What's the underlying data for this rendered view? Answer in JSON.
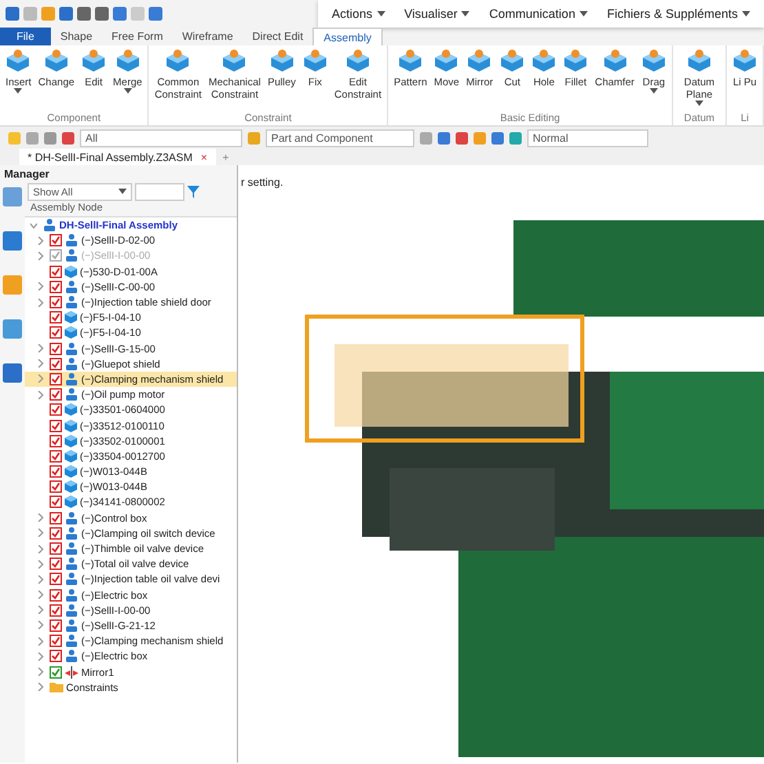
{
  "menu_bar": [
    "Actions",
    "Visualiser",
    "Communication",
    "Fichiers & Suppléments"
  ],
  "ribbon_tabs": [
    {
      "label": "File",
      "selected": false,
      "kind": "file"
    },
    {
      "label": "Shape",
      "selected": false,
      "kind": "tab"
    },
    {
      "label": "Free Form",
      "selected": false,
      "kind": "tab"
    },
    {
      "label": "Wireframe",
      "selected": false,
      "kind": "tab"
    },
    {
      "label": "Direct Edit",
      "selected": false,
      "kind": "tab"
    },
    {
      "label": "Assembly",
      "selected": true,
      "kind": "tab"
    }
  ],
  "ribbon_groups": [
    {
      "label": "Component",
      "buttons": [
        {
          "label": "Insert",
          "dropdown": true
        },
        {
          "label": "Change",
          "dropdown": false
        },
        {
          "label": "Edit",
          "dropdown": false
        },
        {
          "label": "Merge",
          "dropdown": true
        }
      ]
    },
    {
      "label": "Constraint",
      "buttons": [
        {
          "label": "Common Constraint",
          "dropdown": false
        },
        {
          "label": "Mechanical Constraint",
          "dropdown": false
        },
        {
          "label": "Pulley",
          "dropdown": false
        },
        {
          "label": "Fix",
          "dropdown": false
        },
        {
          "label": "Edit Constraint",
          "dropdown": false
        }
      ]
    },
    {
      "label": "Basic Editing",
      "buttons": [
        {
          "label": "Pattern",
          "dropdown": false
        },
        {
          "label": "Move",
          "dropdown": false
        },
        {
          "label": "Mirror",
          "dropdown": false
        },
        {
          "label": "Cut",
          "dropdown": false
        },
        {
          "label": "Hole",
          "dropdown": false
        },
        {
          "label": "Fillet",
          "dropdown": false
        },
        {
          "label": "Chamfer",
          "dropdown": false
        },
        {
          "label": "Drag",
          "dropdown": true
        }
      ]
    },
    {
      "label": "Datum",
      "buttons": [
        {
          "label": "Datum Plane",
          "dropdown": true
        }
      ]
    },
    {
      "label": "Li",
      "buttons": [
        {
          "label": "Li Pu",
          "dropdown": false
        }
      ]
    }
  ],
  "toolbar": {
    "filter": "All",
    "pick_mode": "Part and Component",
    "view_mode": "Normal"
  },
  "document_tab": {
    "title": "* DH-SellI-Final Assembly.Z3ASM",
    "close": "×",
    "add": "+"
  },
  "manager": {
    "title": "Manager",
    "show": "Show All",
    "header": "Assembly Node",
    "root": {
      "label": "DH-SellI-Final Assembly",
      "expanded": true
    },
    "items": [
      {
        "label": "(−)SellI-D-02-00",
        "kind": "assembly",
        "checked": true,
        "expandable": true,
        "selected": false,
        "disabled": false
      },
      {
        "label": "(−)SellI-I-00-00",
        "kind": "assembly",
        "checked": true,
        "expandable": true,
        "selected": false,
        "disabled": true
      },
      {
        "label": "(−)530-D-01-00A",
        "kind": "part",
        "checked": true,
        "expandable": false,
        "selected": false,
        "disabled": false
      },
      {
        "label": "(−)SellI-C-00-00",
        "kind": "assembly",
        "checked": true,
        "expandable": true,
        "selected": false,
        "disabled": false
      },
      {
        "label": "(−)Injection table shield door",
        "kind": "assembly",
        "checked": true,
        "expandable": true,
        "selected": false,
        "disabled": false
      },
      {
        "label": "(−)F5-I-04-10",
        "kind": "part",
        "checked": true,
        "expandable": false,
        "selected": false,
        "disabled": false
      },
      {
        "label": "(−)F5-I-04-10",
        "kind": "part",
        "checked": true,
        "expandable": false,
        "selected": false,
        "disabled": false
      },
      {
        "label": "(−)SellI-G-15-00",
        "kind": "assembly",
        "checked": true,
        "expandable": true,
        "selected": false,
        "disabled": false
      },
      {
        "label": "(−)Gluepot shield",
        "kind": "assembly",
        "checked": true,
        "expandable": true,
        "selected": false,
        "disabled": false
      },
      {
        "label": "(−)Clamping mechanism shield",
        "kind": "assembly",
        "checked": true,
        "expandable": true,
        "selected": true,
        "disabled": false
      },
      {
        "label": "(−)Oil pump motor",
        "kind": "assembly",
        "checked": true,
        "expandable": true,
        "selected": false,
        "disabled": false
      },
      {
        "label": "(−)33501-0604000",
        "kind": "part",
        "checked": true,
        "expandable": false,
        "selected": false,
        "disabled": false
      },
      {
        "label": "(−)33512-0100110",
        "kind": "part",
        "checked": true,
        "expandable": false,
        "selected": false,
        "disabled": false
      },
      {
        "label": "(−)33502-0100001",
        "kind": "part",
        "checked": true,
        "expandable": false,
        "selected": false,
        "disabled": false
      },
      {
        "label": "(−)33504-0012700",
        "kind": "part",
        "checked": true,
        "expandable": false,
        "selected": false,
        "disabled": false
      },
      {
        "label": "(−)W013-044B",
        "kind": "part",
        "checked": true,
        "expandable": false,
        "selected": false,
        "disabled": false
      },
      {
        "label": "(−)W013-044B",
        "kind": "part",
        "checked": true,
        "expandable": false,
        "selected": false,
        "disabled": false
      },
      {
        "label": "(−)34141-0800002",
        "kind": "part",
        "checked": true,
        "expandable": false,
        "selected": false,
        "disabled": false
      },
      {
        "label": "(−)Control box",
        "kind": "assembly",
        "checked": true,
        "expandable": true,
        "selected": false,
        "disabled": false
      },
      {
        "label": "(−)Clamping oil switch device",
        "kind": "assembly",
        "checked": true,
        "expandable": true,
        "selected": false,
        "disabled": false
      },
      {
        "label": "(−)Thimble oil valve device",
        "kind": "assembly",
        "checked": true,
        "expandable": true,
        "selected": false,
        "disabled": false
      },
      {
        "label": "(−)Total oil valve device",
        "kind": "assembly",
        "checked": true,
        "expandable": true,
        "selected": false,
        "disabled": false
      },
      {
        "label": "(−)Injection table oil valve devi",
        "kind": "assembly",
        "checked": true,
        "expandable": true,
        "selected": false,
        "disabled": false
      },
      {
        "label": "(−)Electric box",
        "kind": "assembly",
        "checked": true,
        "expandable": true,
        "selected": false,
        "disabled": false
      },
      {
        "label": "(−)SellI-I-00-00",
        "kind": "assembly",
        "checked": true,
        "expandable": true,
        "selected": false,
        "disabled": false
      },
      {
        "label": "(−)SellI-G-21-12",
        "kind": "assembly",
        "checked": true,
        "expandable": true,
        "selected": false,
        "disabled": false
      },
      {
        "label": "(−)Clamping mechanism shield",
        "kind": "assembly",
        "checked": true,
        "expandable": true,
        "selected": false,
        "disabled": false
      },
      {
        "label": "(−)Electric box",
        "kind": "assembly",
        "checked": true,
        "expandable": true,
        "selected": false,
        "disabled": false
      },
      {
        "label": "Mirror1",
        "kind": "mirror",
        "checked": true,
        "expandable": true,
        "selected": false,
        "disabled": false
      },
      {
        "label": "Constraints",
        "kind": "folder",
        "checked": false,
        "expandable": true,
        "selected": false,
        "disabled": false
      }
    ]
  },
  "viewport": {
    "hint": "r setting."
  }
}
